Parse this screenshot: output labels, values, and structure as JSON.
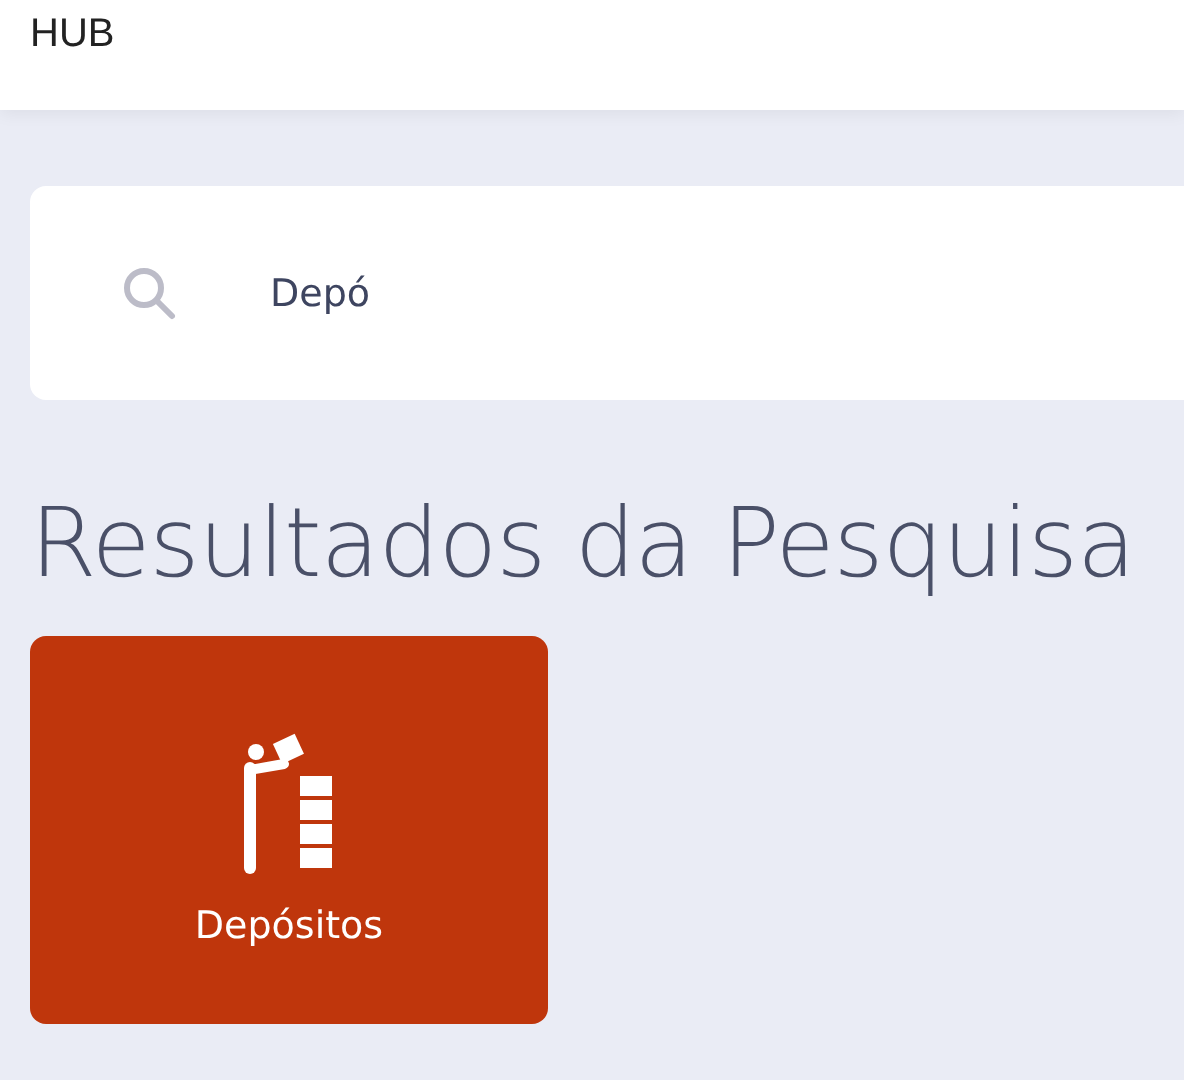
{
  "header": {
    "title": "HUB"
  },
  "search": {
    "value": "Depó"
  },
  "results_title": "Resultados da Pesquisa",
  "results": [
    {
      "label": "Depósitos",
      "color": "#bf360c"
    }
  ]
}
